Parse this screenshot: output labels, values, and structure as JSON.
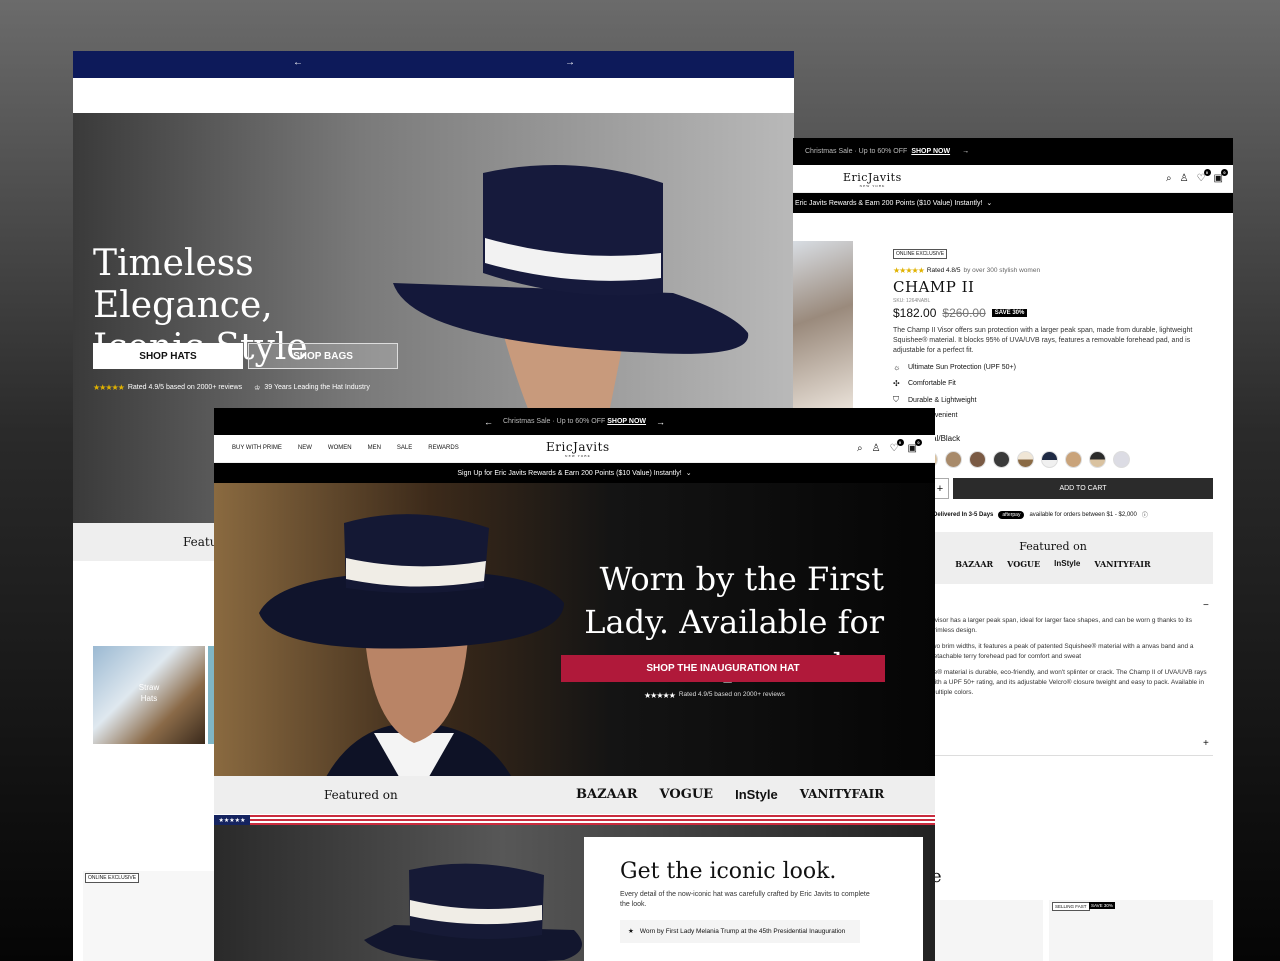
{
  "window_a": {
    "hero_title": "Timeless Elegance, Iconic Style",
    "shop_hats": "SHOP HATS",
    "shop_bags": "SHOP BAGS",
    "stars": "★★★★★",
    "rating": "Rated 4.9/5 based on 2000+ reviews",
    "years": "39 Years Leading the Hat Industry",
    "featured": "Featur",
    "category": "Straw Hats",
    "badge": "ONLINE EXCLUSIVE",
    "arrow_left": "←",
    "arrow_right": "→"
  },
  "window_b": {
    "promo_text": "Christmas Sale · Up to 60% OFF",
    "promo_link": "SHOP NOW",
    "logo": "EricJavits",
    "logo_sub": "NEW YORK",
    "rewards": "Eric Javits Rewards & Earn 200 Points ($10 Value) Instantly!",
    "cart_count": "0",
    "wish_count": "0",
    "tag": "ONLINE EXCLUSIVE",
    "stars": "★★★★★",
    "rating_text": "Rated 4.8/5",
    "rating_suffix": "by over 300 stylish women",
    "product_name": "CHAMP II",
    "sku": "SKU: 1264NABL",
    "price": "$182.00",
    "compare_price": "$260.00",
    "save": "SAVE 30%",
    "description": "The Champ II Visor offers sun protection with a larger peak span, made from durable, lightweight Squishee® material. It blocks 95% of UVA/UVB rays, features a removable forehead pad, and is adjustable for a perfect fit.",
    "features": [
      {
        "icon": "sun-icon",
        "label": "Ultimate Sun Protection (UPF 50+)"
      },
      {
        "icon": "adjust-icon",
        "label": "Comfortable Fit"
      },
      {
        "icon": "shield-icon",
        "label": "Durable & Lightweight"
      },
      {
        "icon": "bag-icon",
        "label": "le & Convenient"
      }
    ],
    "color_label": "ural/Black",
    "swatches": [
      "#d9c2a0",
      "#a88a6a",
      "#7a5a44",
      "#3a3a3a",
      "#f0e6d6",
      "#1f2a44",
      "#c9a37a",
      "#2b2b2b",
      "#dcdce4"
    ],
    "qty_plus": "+",
    "add_to_cart": "ADD TO CART",
    "ship": "Delivered In 3-5 Days",
    "afterpay": "afterpay",
    "afterpay_text": "available for orders between $1 - $2,000",
    "featured_title": "Featured on",
    "featured_logos": [
      "BAZAAR",
      "VOGUE",
      "InStyle",
      "VANITYFAIR"
    ],
    "acc_text": [
      "ll visor has a larger peak span, ideal for larger face shapes, and can be worn g thanks to its brimless design.",
      "two brim widths, it features a peak of patented Squishee® material with a anvas band and a detachable terry forehead pad for comfort and sweat",
      "ee® material is durable, eco-friendly, and won't splinter or crack. The Champ II of UVA/UVB rays with a UPF 50+ rating, and its adjustable Velcro® closure tweight and easy to pack. Available in multiple colors."
    ],
    "minus": "−",
    "plus": "+",
    "section_heading": "e",
    "badge_selling": "SELLING FAST",
    "badge_save": "SAVE 30%",
    "badge_save_short": "0%"
  },
  "window_c": {
    "promo_text": "Christmas Sale · Up to 60% OFF",
    "promo_link": "SHOP NOW",
    "arrow_left": "←",
    "arrow_right": "→",
    "menu": [
      "BUY WITH PRIME",
      "NEW",
      "WOMEN",
      "MEN",
      "SALE",
      "REWARDS"
    ],
    "logo": "EricJavits",
    "logo_sub": "NEW YORK",
    "cart_count": "0",
    "wish_count": "0",
    "signup": "Sign Up for Eric Javits Rewards & Earn 200 Points ($10 Value) Instantly!",
    "hero_title": "Worn by the First Lady. Available for pre-order.",
    "cta": "SHOP THE INAUGURATION HAT",
    "stars": "★★★★★",
    "rating": "Rated 4.9/5 based on 2000+ reviews",
    "featured_title": "Featured on",
    "featured_logos": [
      "BAZAAR",
      "VOGUE",
      "InStyle",
      "VANITYFAIR"
    ],
    "flag_stars": "★★★★★",
    "look_title": "Get the iconic look.",
    "look_desc": "Every detail of the now-iconic hat was carefully crafted by Eric Javits to complete the look.",
    "look_item": "Worn by First Lady Melania Trump at the 45th Presidential Inauguration",
    "look_bullet": "★"
  }
}
